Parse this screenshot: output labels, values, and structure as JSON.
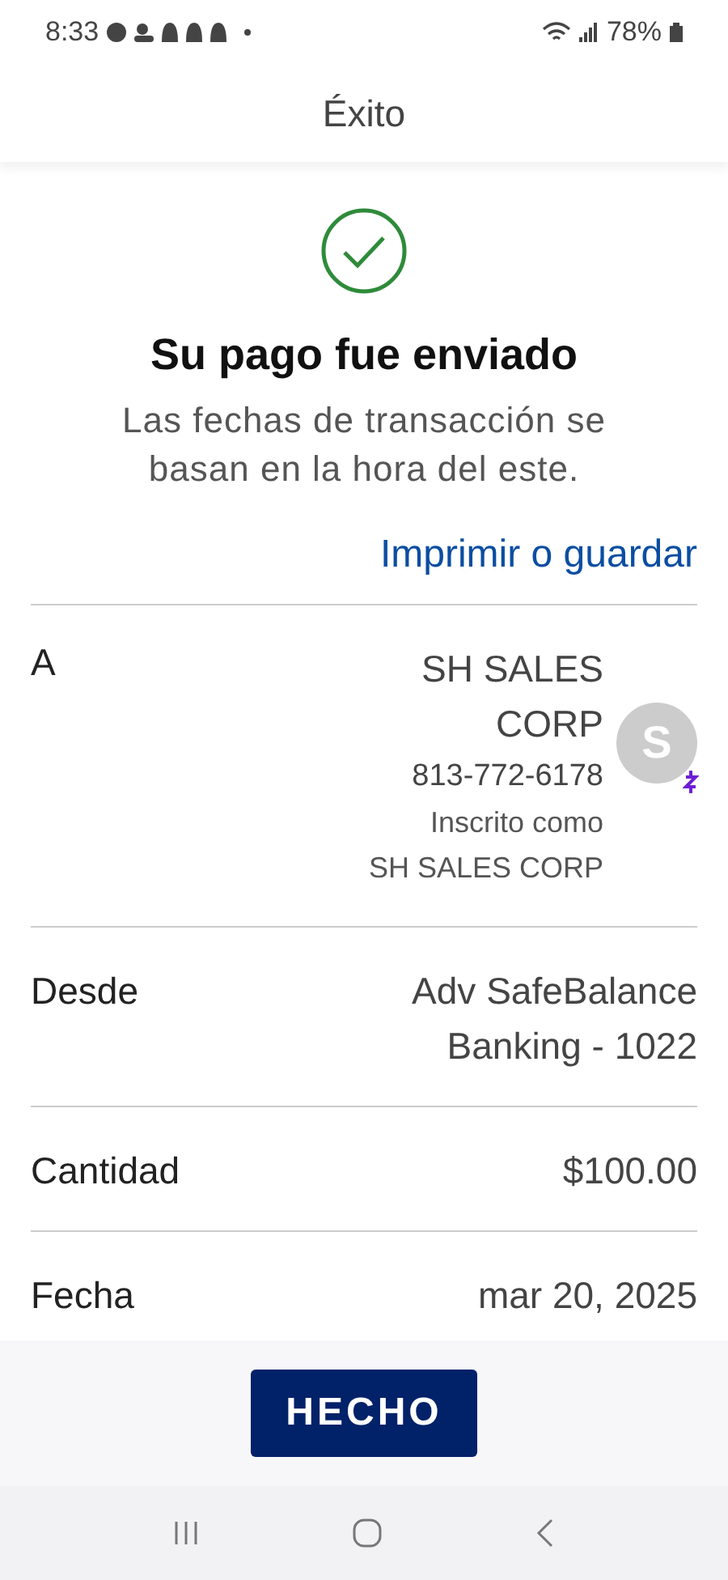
{
  "status_bar": {
    "time": "8:33",
    "battery": "78%"
  },
  "header": {
    "title": "Éxito"
  },
  "success": {
    "title": "Su pago fue enviado",
    "subtitle": "Las fechas de transacción se basan en la hora del este."
  },
  "print_link": "Imprimir o guardar",
  "details": [
    {
      "kind": "recipient",
      "label": "A",
      "value": "SH SALES CORP",
      "phone": "813-772-6178",
      "note_lines": [
        "Inscrito como",
        "SH SALES CORP"
      ],
      "avatar": "S"
    },
    {
      "kind": "plain",
      "label": "Desde",
      "value": "Adv SafeBalance Banking - 1022"
    },
    {
      "kind": "plain",
      "label": "Cantidad",
      "value": "$100.00"
    },
    {
      "kind": "plain",
      "label": "Fecha",
      "value": "mar 20, 2025"
    }
  ],
  "done_button": "HECHO"
}
